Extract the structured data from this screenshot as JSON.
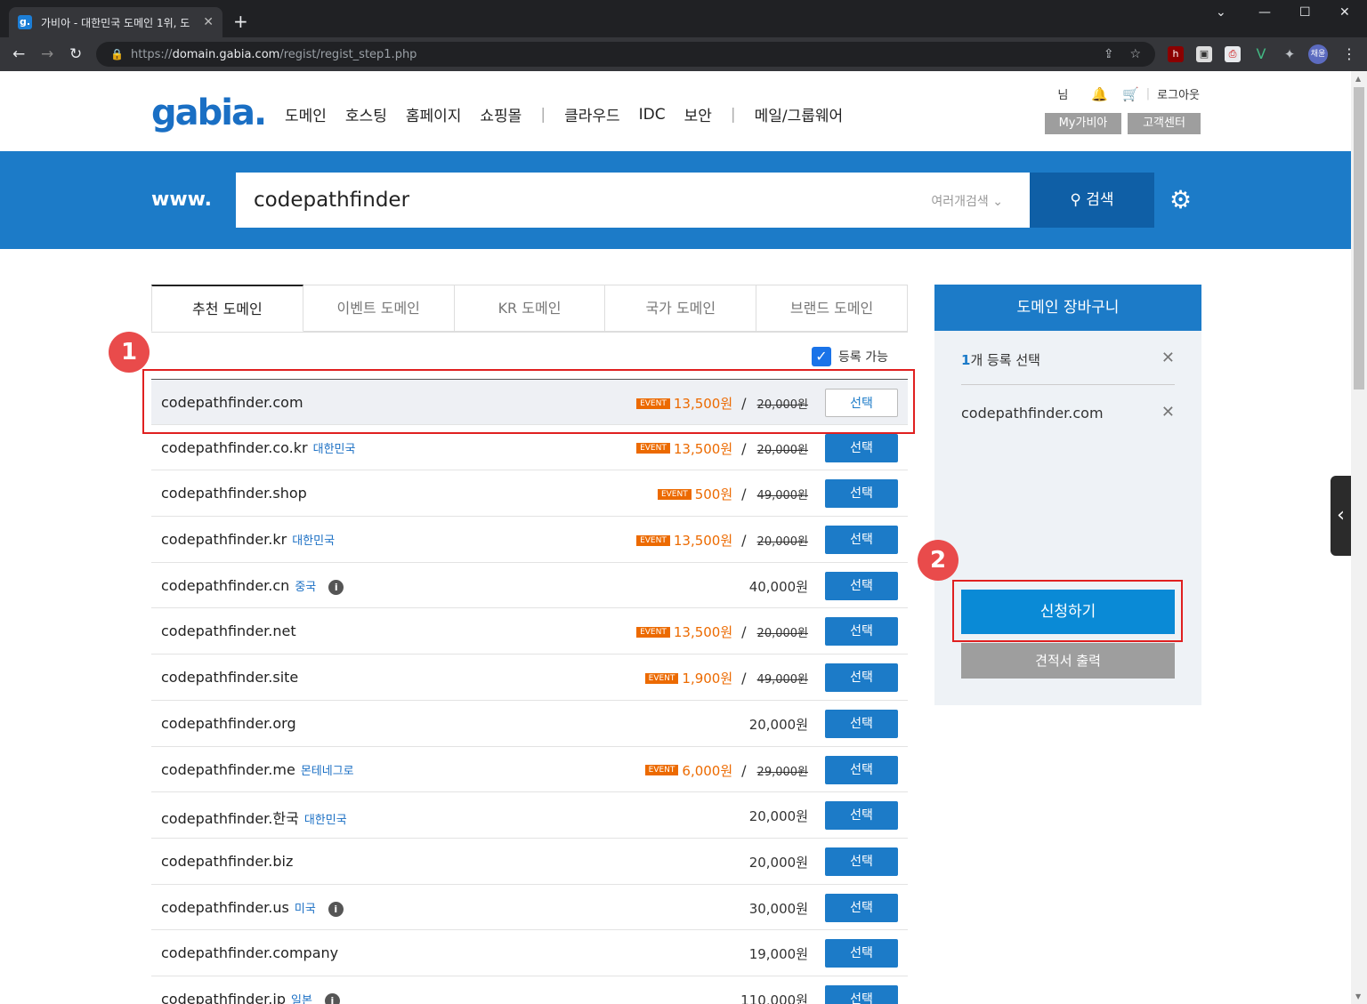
{
  "browser": {
    "tab_title": "가비아 - 대한민국 도메인 1위, 도",
    "tab_favicon": "g.",
    "url_host": "domain.gabia.com",
    "url_prefix": "https://",
    "url_path": "/regist/regist_step1.php",
    "profile": "채윤"
  },
  "header": {
    "logo": "gabia.",
    "nav": [
      "도메인",
      "호스팅",
      "홈페이지",
      "쇼핑몰",
      "클라우드",
      "IDC",
      "보안",
      "메일/그룹웨어"
    ],
    "user_suffix": "님",
    "logout": "로그아웃",
    "my_gabia": "My가비아",
    "support": "고객센터"
  },
  "search": {
    "prefix": "www.",
    "query": "codepathfinder",
    "multi_label": "여러개검색",
    "button": "검색"
  },
  "tabs": [
    "추천 도메인",
    "이벤트 도메인",
    "KR 도메인",
    "국가 도메인",
    "브랜드 도메인"
  ],
  "filter": {
    "available_label": "등록 가능",
    "checked": true
  },
  "rows": [
    {
      "domain": "codepathfinder.com",
      "country": "",
      "info": false,
      "event": true,
      "price": "13,500원",
      "original": "20,000원",
      "selected": true
    },
    {
      "domain": "codepathfinder.co.kr",
      "country": "대한민국",
      "info": false,
      "event": true,
      "price": "13,500원",
      "original": "20,000원",
      "selected": false
    },
    {
      "domain": "codepathfinder.shop",
      "country": "",
      "info": false,
      "event": true,
      "price": "500원",
      "original": "49,000원",
      "selected": false
    },
    {
      "domain": "codepathfinder.kr",
      "country": "대한민국",
      "info": false,
      "event": true,
      "price": "13,500원",
      "original": "20,000원",
      "selected": false
    },
    {
      "domain": "codepathfinder.cn",
      "country": "중국",
      "info": true,
      "event": false,
      "price": "40,000원",
      "original": "",
      "selected": false
    },
    {
      "domain": "codepathfinder.net",
      "country": "",
      "info": false,
      "event": true,
      "price": "13,500원",
      "original": "20,000원",
      "selected": false
    },
    {
      "domain": "codepathfinder.site",
      "country": "",
      "info": false,
      "event": true,
      "price": "1,900원",
      "original": "49,000원",
      "selected": false
    },
    {
      "domain": "codepathfinder.org",
      "country": "",
      "info": false,
      "event": false,
      "price": "20,000원",
      "original": "",
      "selected": false
    },
    {
      "domain": "codepathfinder.me",
      "country": "몬테네그로",
      "info": false,
      "event": true,
      "price": "6,000원",
      "original": "29,000원",
      "selected": false
    },
    {
      "domain": "codepathfinder.한국",
      "country": "대한민국",
      "info": false,
      "event": false,
      "price": "20,000원",
      "original": "",
      "selected": false
    },
    {
      "domain": "codepathfinder.biz",
      "country": "",
      "info": false,
      "event": false,
      "price": "20,000원",
      "original": "",
      "selected": false
    },
    {
      "domain": "codepathfinder.us",
      "country": "미국",
      "info": true,
      "event": false,
      "price": "30,000원",
      "original": "",
      "selected": false
    },
    {
      "domain": "codepathfinder.company",
      "country": "",
      "info": false,
      "event": false,
      "price": "19,000원",
      "original": "",
      "selected": false
    },
    {
      "domain": "codepathfinder.jp",
      "country": "일본",
      "info": true,
      "event": false,
      "price": "110,000원",
      "original": "",
      "selected": false
    }
  ],
  "labels": {
    "event_badge": "EVENT",
    "select_button": "선택",
    "info_glyph": "i",
    "slash": "/"
  },
  "cart": {
    "title": "도메인 장바구니",
    "count_num": "1",
    "count_text": "개 등록 선택",
    "item": "codepathfinder.com",
    "apply": "신청하기",
    "quote": "견적서 출력"
  },
  "callouts": [
    "1",
    "2"
  ],
  "colors": {
    "brand": "#1c7bc8",
    "event": "#ec6a00",
    "callout": "#e02020"
  }
}
